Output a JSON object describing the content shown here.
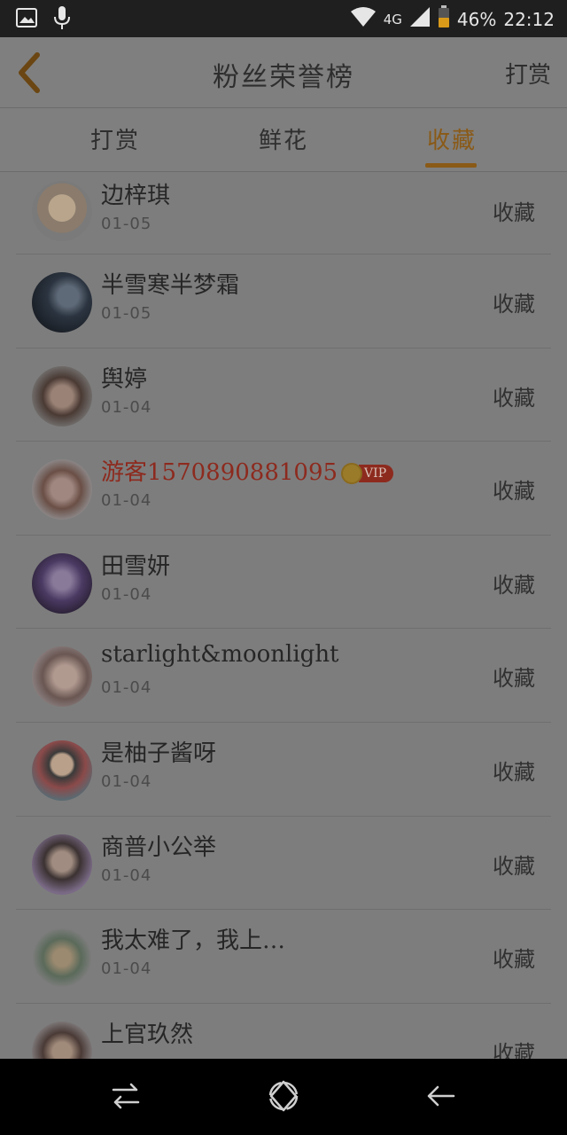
{
  "status_bar": {
    "network": "4G",
    "battery": "46%",
    "time": "22:12",
    "icons": [
      "image-icon",
      "mic-icon",
      "wifi-icon",
      "signal-icon",
      "battery-icon"
    ]
  },
  "header": {
    "title": "粉丝荣誉榜",
    "action": "打赏",
    "back_icon": "chevron-left-icon"
  },
  "tabs": [
    {
      "label": "打赏",
      "active": false
    },
    {
      "label": "鲜花",
      "active": false
    },
    {
      "label": "收藏",
      "active": true
    }
  ],
  "colors": {
    "accent": "#8a5a17",
    "vip_name": "#8d2a1e",
    "overlay_bg": "#7d7d7d"
  },
  "list": [
    {
      "name": "边梓琪",
      "date": "01-05",
      "action": "收藏",
      "vip": false
    },
    {
      "name": "半雪寒半梦霜",
      "date": "01-05",
      "action": "收藏",
      "vip": false
    },
    {
      "name": "舆婷",
      "date": "01-04",
      "action": "收藏",
      "vip": false
    },
    {
      "name": "游客1570890881095",
      "date": "01-04",
      "action": "收藏",
      "vip": true,
      "badge": "VIP"
    },
    {
      "name": "田雪妍",
      "date": "01-04",
      "action": "收藏",
      "vip": false
    },
    {
      "name": "starlight&moonlight",
      "date": "01-04",
      "action": "收藏",
      "vip": false
    },
    {
      "name": "是柚子酱呀",
      "date": "01-04",
      "action": "收藏",
      "vip": false
    },
    {
      "name": "商普小公举",
      "date": "01-04",
      "action": "收藏",
      "vip": false
    },
    {
      "name": "我太难了，我上…",
      "date": "01-04",
      "action": "收藏",
      "vip": false
    },
    {
      "name": "上官玖然",
      "date": "",
      "action": "收藏",
      "vip": false
    }
  ],
  "nav_bar": {
    "buttons": [
      "recent-apps-icon",
      "home-icon",
      "back-icon"
    ]
  }
}
